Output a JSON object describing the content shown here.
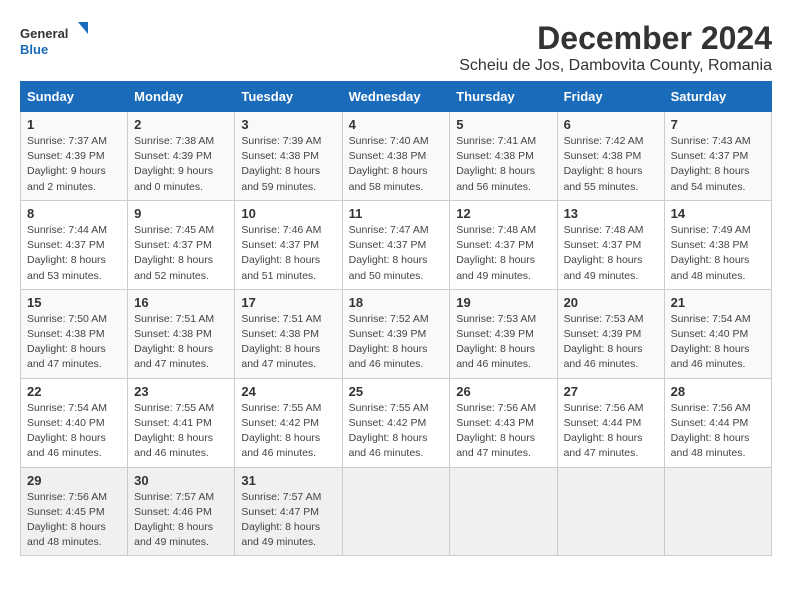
{
  "header": {
    "logo_general": "General",
    "logo_blue": "Blue",
    "title": "December 2024",
    "subtitle": "Scheiu de Jos, Dambovita County, Romania"
  },
  "weekdays": [
    "Sunday",
    "Monday",
    "Tuesday",
    "Wednesday",
    "Thursday",
    "Friday",
    "Saturday"
  ],
  "weeks": [
    [
      {
        "day": "1",
        "sunrise": "7:37 AM",
        "sunset": "4:39 PM",
        "daylight": "9 hours and 2 minutes."
      },
      {
        "day": "2",
        "sunrise": "7:38 AM",
        "sunset": "4:39 PM",
        "daylight": "9 hours and 0 minutes."
      },
      {
        "day": "3",
        "sunrise": "7:39 AM",
        "sunset": "4:38 PM",
        "daylight": "8 hours and 59 minutes."
      },
      {
        "day": "4",
        "sunrise": "7:40 AM",
        "sunset": "4:38 PM",
        "daylight": "8 hours and 58 minutes."
      },
      {
        "day": "5",
        "sunrise": "7:41 AM",
        "sunset": "4:38 PM",
        "daylight": "8 hours and 56 minutes."
      },
      {
        "day": "6",
        "sunrise": "7:42 AM",
        "sunset": "4:38 PM",
        "daylight": "8 hours and 55 minutes."
      },
      {
        "day": "7",
        "sunrise": "7:43 AM",
        "sunset": "4:37 PM",
        "daylight": "8 hours and 54 minutes."
      }
    ],
    [
      {
        "day": "8",
        "sunrise": "7:44 AM",
        "sunset": "4:37 PM",
        "daylight": "8 hours and 53 minutes."
      },
      {
        "day": "9",
        "sunrise": "7:45 AM",
        "sunset": "4:37 PM",
        "daylight": "8 hours and 52 minutes."
      },
      {
        "day": "10",
        "sunrise": "7:46 AM",
        "sunset": "4:37 PM",
        "daylight": "8 hours and 51 minutes."
      },
      {
        "day": "11",
        "sunrise": "7:47 AM",
        "sunset": "4:37 PM",
        "daylight": "8 hours and 50 minutes."
      },
      {
        "day": "12",
        "sunrise": "7:48 AM",
        "sunset": "4:37 PM",
        "daylight": "8 hours and 49 minutes."
      },
      {
        "day": "13",
        "sunrise": "7:48 AM",
        "sunset": "4:37 PM",
        "daylight": "8 hours and 49 minutes."
      },
      {
        "day": "14",
        "sunrise": "7:49 AM",
        "sunset": "4:38 PM",
        "daylight": "8 hours and 48 minutes."
      }
    ],
    [
      {
        "day": "15",
        "sunrise": "7:50 AM",
        "sunset": "4:38 PM",
        "daylight": "8 hours and 47 minutes."
      },
      {
        "day": "16",
        "sunrise": "7:51 AM",
        "sunset": "4:38 PM",
        "daylight": "8 hours and 47 minutes."
      },
      {
        "day": "17",
        "sunrise": "7:51 AM",
        "sunset": "4:38 PM",
        "daylight": "8 hours and 47 minutes."
      },
      {
        "day": "18",
        "sunrise": "7:52 AM",
        "sunset": "4:39 PM",
        "daylight": "8 hours and 46 minutes."
      },
      {
        "day": "19",
        "sunrise": "7:53 AM",
        "sunset": "4:39 PM",
        "daylight": "8 hours and 46 minutes."
      },
      {
        "day": "20",
        "sunrise": "7:53 AM",
        "sunset": "4:39 PM",
        "daylight": "8 hours and 46 minutes."
      },
      {
        "day": "21",
        "sunrise": "7:54 AM",
        "sunset": "4:40 PM",
        "daylight": "8 hours and 46 minutes."
      }
    ],
    [
      {
        "day": "22",
        "sunrise": "7:54 AM",
        "sunset": "4:40 PM",
        "daylight": "8 hours and 46 minutes."
      },
      {
        "day": "23",
        "sunrise": "7:55 AM",
        "sunset": "4:41 PM",
        "daylight": "8 hours and 46 minutes."
      },
      {
        "day": "24",
        "sunrise": "7:55 AM",
        "sunset": "4:42 PM",
        "daylight": "8 hours and 46 minutes."
      },
      {
        "day": "25",
        "sunrise": "7:55 AM",
        "sunset": "4:42 PM",
        "daylight": "8 hours and 46 minutes."
      },
      {
        "day": "26",
        "sunrise": "7:56 AM",
        "sunset": "4:43 PM",
        "daylight": "8 hours and 47 minutes."
      },
      {
        "day": "27",
        "sunrise": "7:56 AM",
        "sunset": "4:44 PM",
        "daylight": "8 hours and 47 minutes."
      },
      {
        "day": "28",
        "sunrise": "7:56 AM",
        "sunset": "4:44 PM",
        "daylight": "8 hours and 48 minutes."
      }
    ],
    [
      {
        "day": "29",
        "sunrise": "7:56 AM",
        "sunset": "4:45 PM",
        "daylight": "8 hours and 48 minutes."
      },
      {
        "day": "30",
        "sunrise": "7:57 AM",
        "sunset": "4:46 PM",
        "daylight": "8 hours and 49 minutes."
      },
      {
        "day": "31",
        "sunrise": "7:57 AM",
        "sunset": "4:47 PM",
        "daylight": "8 hours and 49 minutes."
      },
      null,
      null,
      null,
      null
    ]
  ]
}
